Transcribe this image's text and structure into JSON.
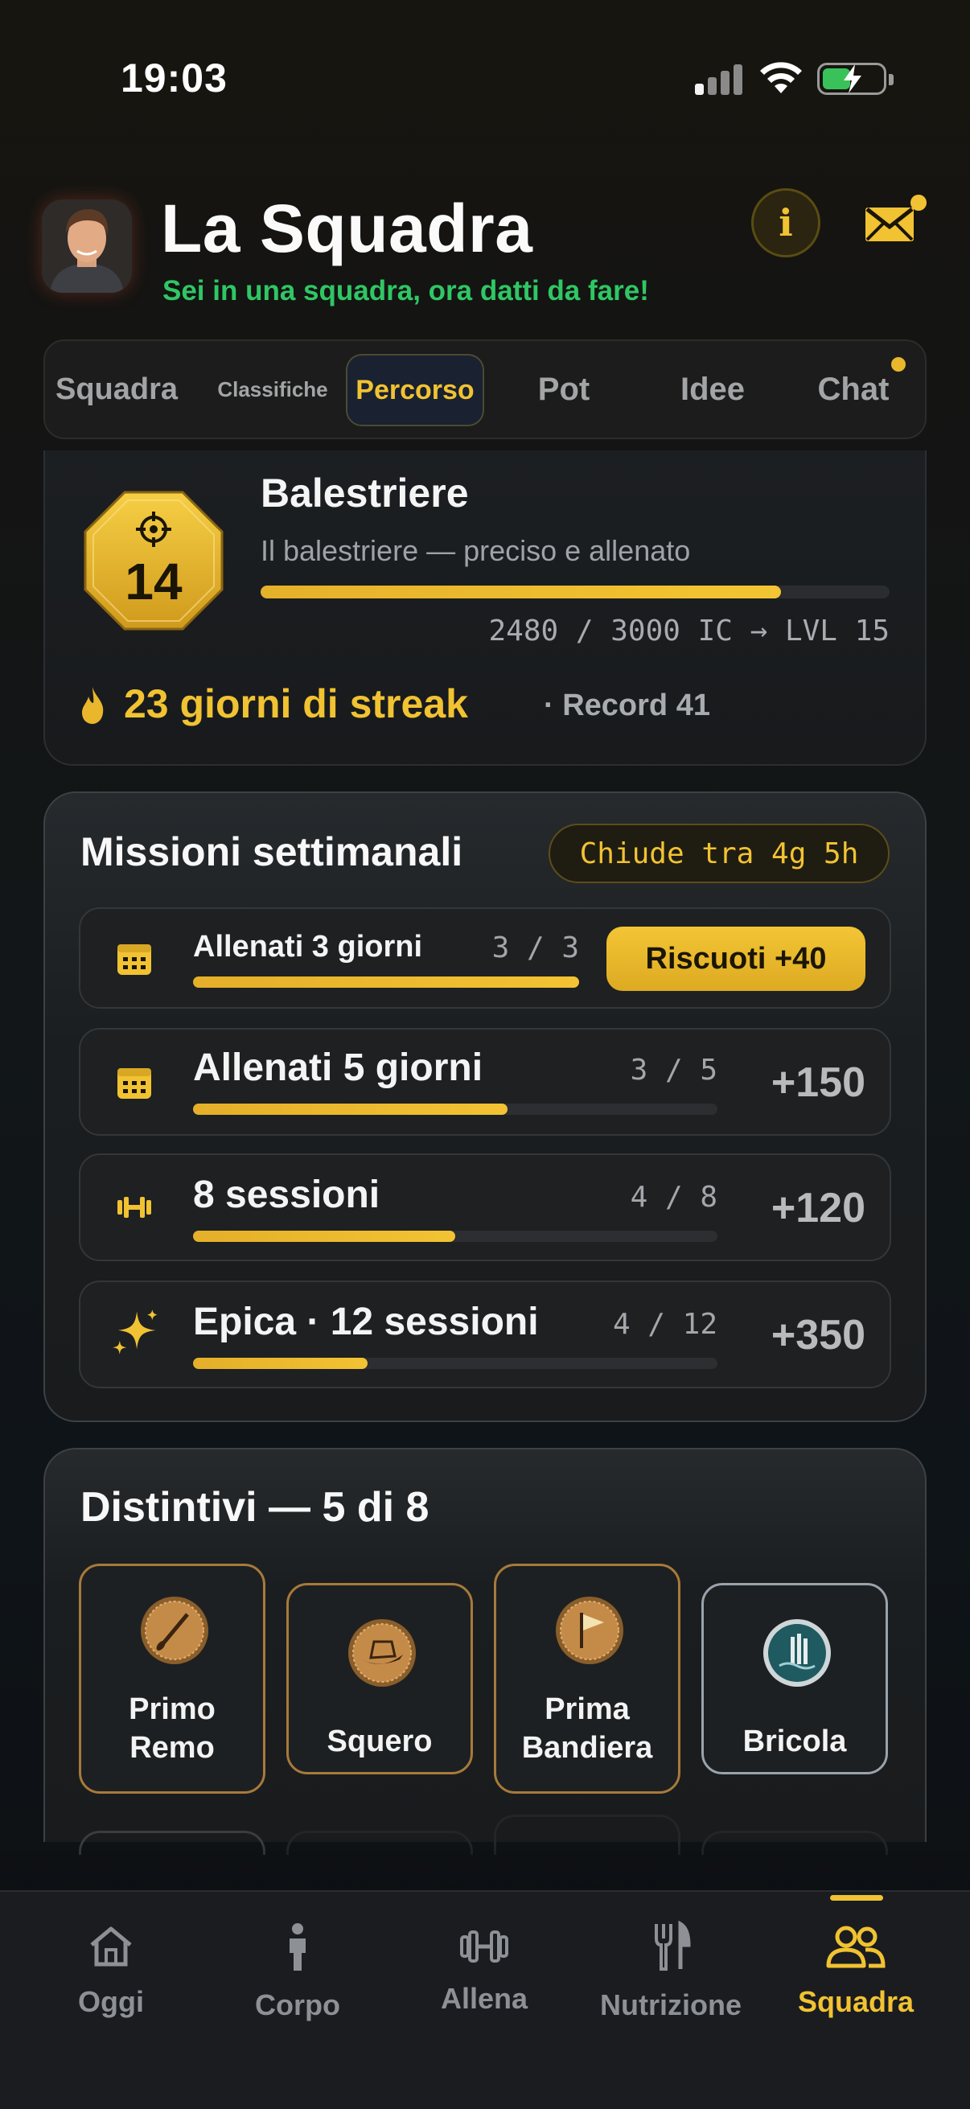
{
  "status_bar": {
    "time": "19:03"
  },
  "header": {
    "title": "La Squadra",
    "subtitle": "Sei in una squadra, ora datti da fare!",
    "info_label": "i"
  },
  "tabs": [
    {
      "label": "Squadra",
      "active": false
    },
    {
      "label": "Classifiche",
      "active": false
    },
    {
      "label": "Percorso",
      "active": true
    },
    {
      "label": "Pot",
      "active": false
    },
    {
      "label": "Idee",
      "active": false
    },
    {
      "label": "Chat",
      "active": false,
      "has_notification": true
    }
  ],
  "level": {
    "number": "14",
    "rank_title": "Balestriere",
    "rank_description": "Il balestriere — preciso e allenato",
    "xp_progress": 0.827,
    "xp_text": "2480 / 3000 IC → LVL 15",
    "streak_text": "23 giorni di streak",
    "record_text": "· Record 41"
  },
  "missions": {
    "title": "Missioni settimanali",
    "deadline": "Chiude tra 4g 5h",
    "items": [
      {
        "icon": "calendar-icon",
        "label": "Allenati 3 giorni",
        "count": "3 / 3",
        "progress": 1.0,
        "claim_label": "Riscuoti +40"
      },
      {
        "icon": "calendar-icon",
        "label": "Allenati 5 giorni",
        "count": "3 / 5",
        "progress": 0.6,
        "reward": "+150"
      },
      {
        "icon": "dumbbell-icon",
        "label": "8 sessioni",
        "count": "4 / 8",
        "progress": 0.5,
        "reward": "+120"
      },
      {
        "icon": "sparkle-icon",
        "label": "Epica · 12 sessioni",
        "count": "4 / 12",
        "progress": 0.333,
        "reward": "+350"
      }
    ]
  },
  "badges": {
    "title": "Distintivi — 5 di 8",
    "items": [
      {
        "label": "Primo Remo",
        "line1": "Primo",
        "line2": "Remo",
        "icon": "oar-medal-icon"
      },
      {
        "label": "Squero",
        "line1": "Squero",
        "line2": "",
        "icon": "gondola-medal-icon"
      },
      {
        "label": "Prima Bandiera",
        "line1": "Prima",
        "line2": "Bandiera",
        "icon": "flag-medal-icon"
      },
      {
        "label": "Bricola",
        "line1": "Bricola",
        "line2": "",
        "icon": "bricola-medal-icon"
      }
    ]
  },
  "bottom_nav": [
    {
      "label": "Oggi",
      "icon": "home-icon",
      "active": false
    },
    {
      "label": "Corpo",
      "icon": "person-icon",
      "active": false
    },
    {
      "label": "Allena",
      "icon": "dumbbell-icon",
      "active": false
    },
    {
      "label": "Nutrizione",
      "icon": "fork-knife-icon",
      "active": false
    },
    {
      "label": "Squadra",
      "icon": "team-icon",
      "active": true
    }
  ],
  "colors": {
    "accent": "#f1c232",
    "subtitle_green": "#2fc764",
    "background": "#121618"
  }
}
